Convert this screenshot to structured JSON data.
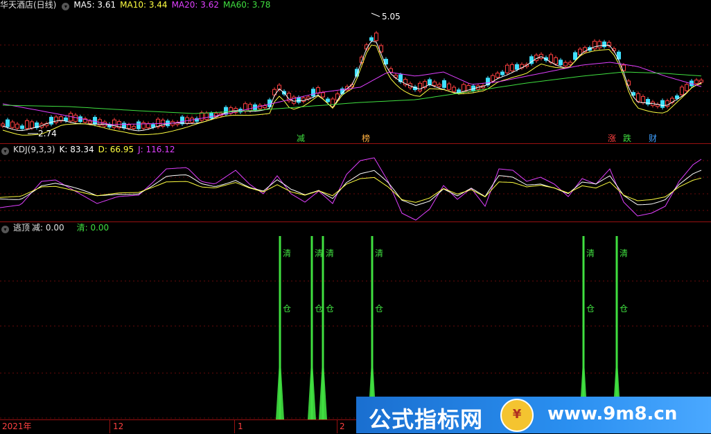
{
  "main_panel": {
    "title": "华天酒店(日线)",
    "ma5": "MA5: 3.61",
    "ma10": "MA10: 3.44",
    "ma20": "MA20: 3.62",
    "ma60": "MA60: 3.78",
    "high_label": "5.05",
    "low_label": "2.74",
    "event_tags": [
      "减",
      "榜",
      "涨",
      "跌",
      "财"
    ],
    "colors": {
      "ma5": "#ffffff",
      "ma10": "#ffff40",
      "ma20": "#e040ff",
      "ma60": "#40e040",
      "up": "#ff4040",
      "down": "#40e0ff"
    }
  },
  "kdj_panel": {
    "title": "KDJ(9,3,3)",
    "k": "K: 83.34",
    "d": "D: 66.95",
    "j": "J: 116.12"
  },
  "signal_panel": {
    "title": "逃顶",
    "jian": "减: 0.00",
    "qing": "清: 0.00",
    "label_top": "清",
    "label_bottom": "仓"
  },
  "x_axis": {
    "labels": [
      "2021年",
      "12",
      "1",
      "2"
    ]
  },
  "watermark": {
    "text": "公式指标网",
    "url": "www.9m8.cn",
    "logo_char": "¥"
  }
}
